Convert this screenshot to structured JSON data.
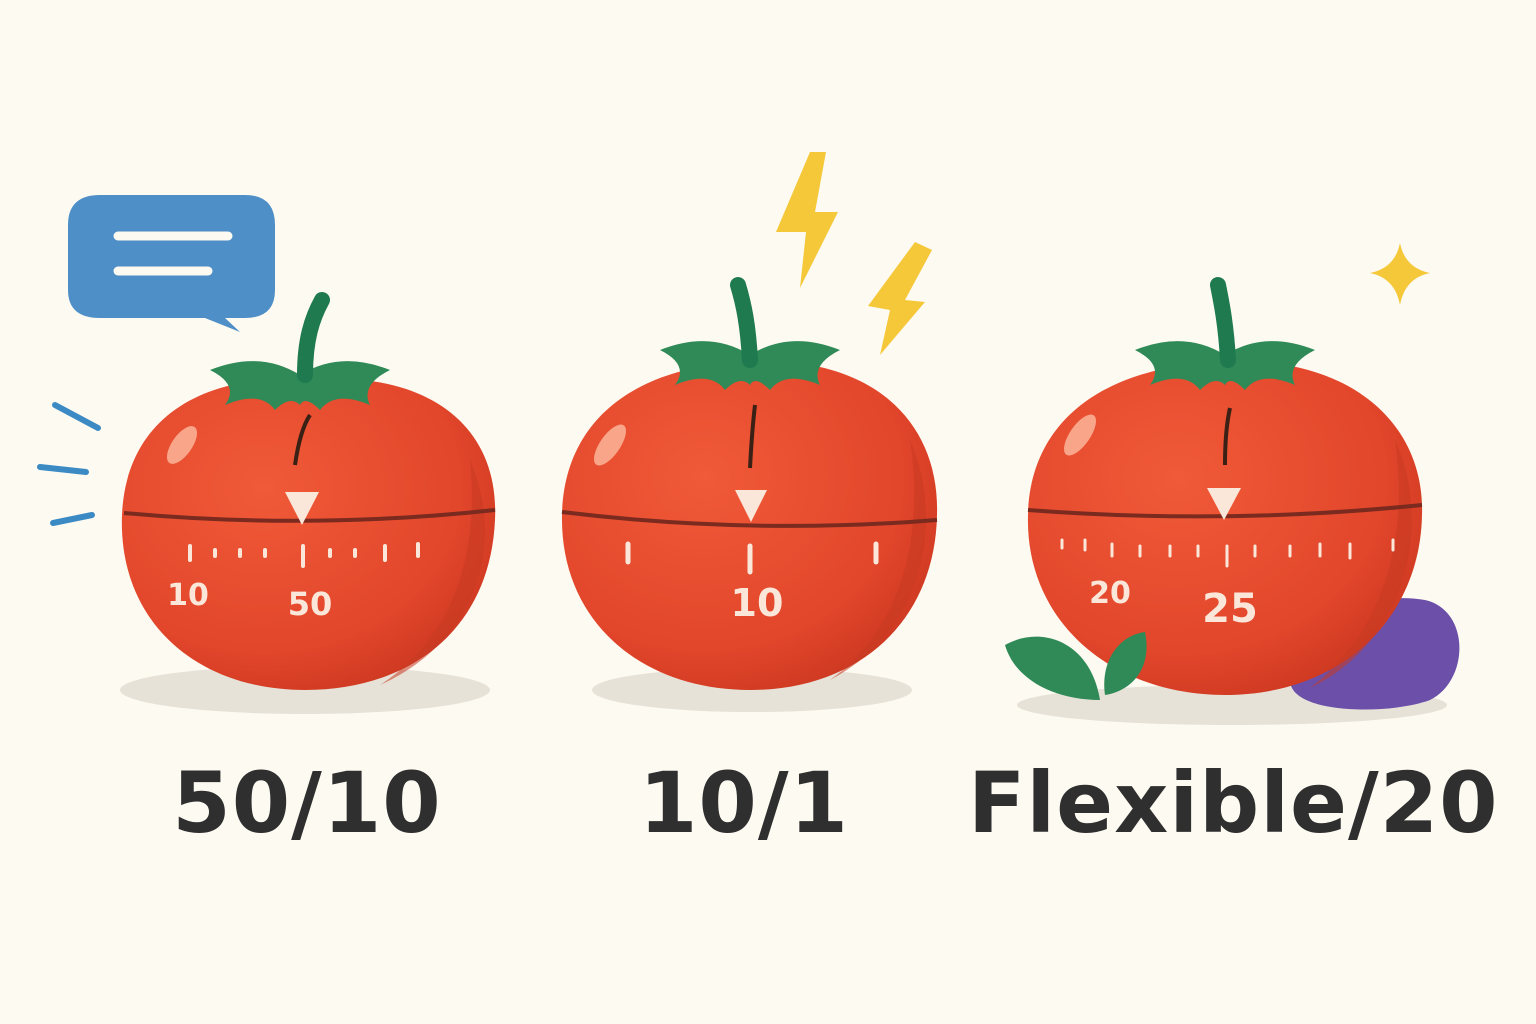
{
  "timers": [
    {
      "label": "50/10",
      "dial_numbers": [
        "10",
        "50"
      ],
      "accent": "speech-bubble-icon",
      "colors": {
        "body": "#e64a2e",
        "leaves": "#2e8b57",
        "accent": "#4d8fc6"
      }
    },
    {
      "label": "10/1",
      "dial_numbers": [
        "10"
      ],
      "accent": "lightning-bolt-icon",
      "colors": {
        "body": "#e64a2e",
        "leaves": "#2e8b57",
        "accent": "#f5c83a"
      }
    },
    {
      "label": "Flexible/20",
      "dial_numbers": [
        "20",
        "25"
      ],
      "accent": "sparkle-icon",
      "colors": {
        "body": "#e64a2e",
        "leaves": "#2e8b57",
        "accent": "#f5c83a",
        "stone": "#6b4fa8"
      }
    }
  ]
}
